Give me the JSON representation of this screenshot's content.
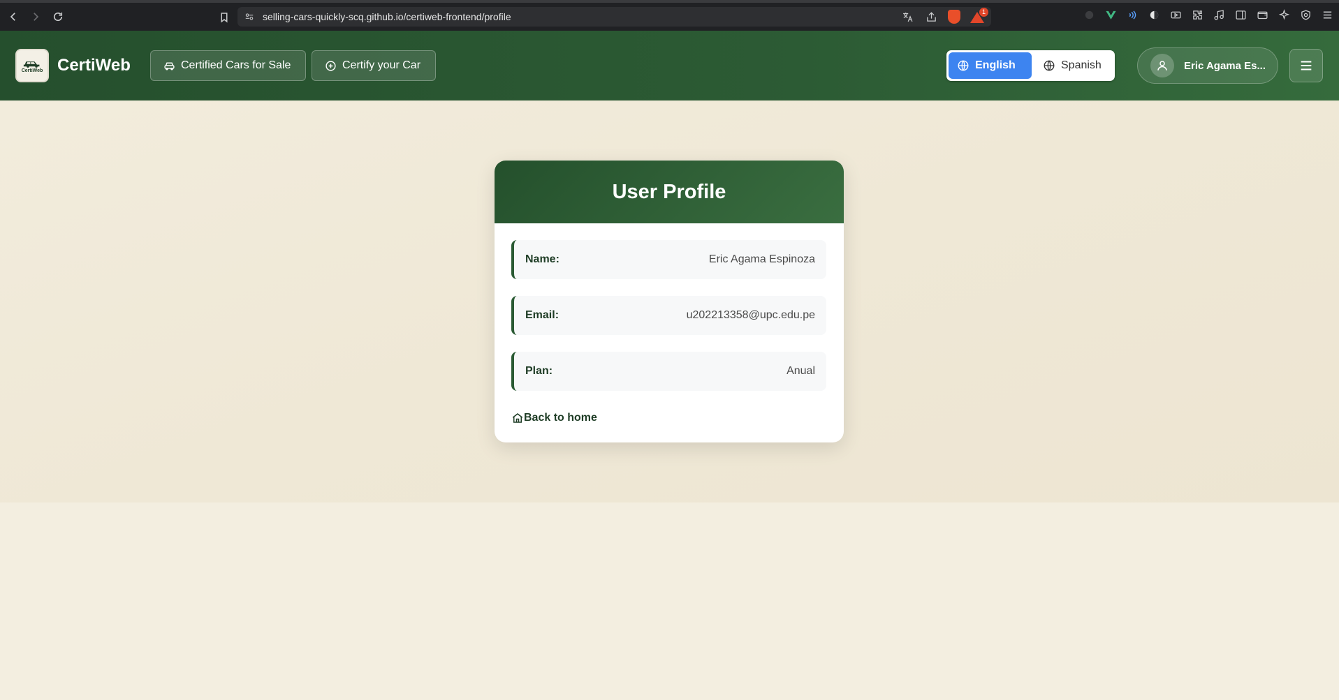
{
  "browser": {
    "url": "selling-cars-quickly-scq.github.io/certiweb-frontend/profile",
    "rewards_badge": "1"
  },
  "header": {
    "brand": "CertiWeb",
    "logo_text": "CertiWeb",
    "nav": {
      "cars_label": "Certified Cars for Sale",
      "certify_label": "Certify your Car"
    },
    "languages": {
      "english": "English",
      "spanish": "Spanish",
      "active": "English"
    },
    "user_name": "Eric Agama Es..."
  },
  "profile": {
    "title": "User Profile",
    "fields": {
      "name_label": "Name:",
      "name_value": "Eric Agama Espinoza",
      "email_label": "Email:",
      "email_value": "u202213358@upc.edu.pe",
      "plan_label": "Plan:",
      "plan_value": "Anual"
    },
    "back_label": "Back to home"
  },
  "colors": {
    "header_green": "#2c5b34",
    "accent_blue": "#3d84f0",
    "page_bg": "#f2eedf"
  }
}
